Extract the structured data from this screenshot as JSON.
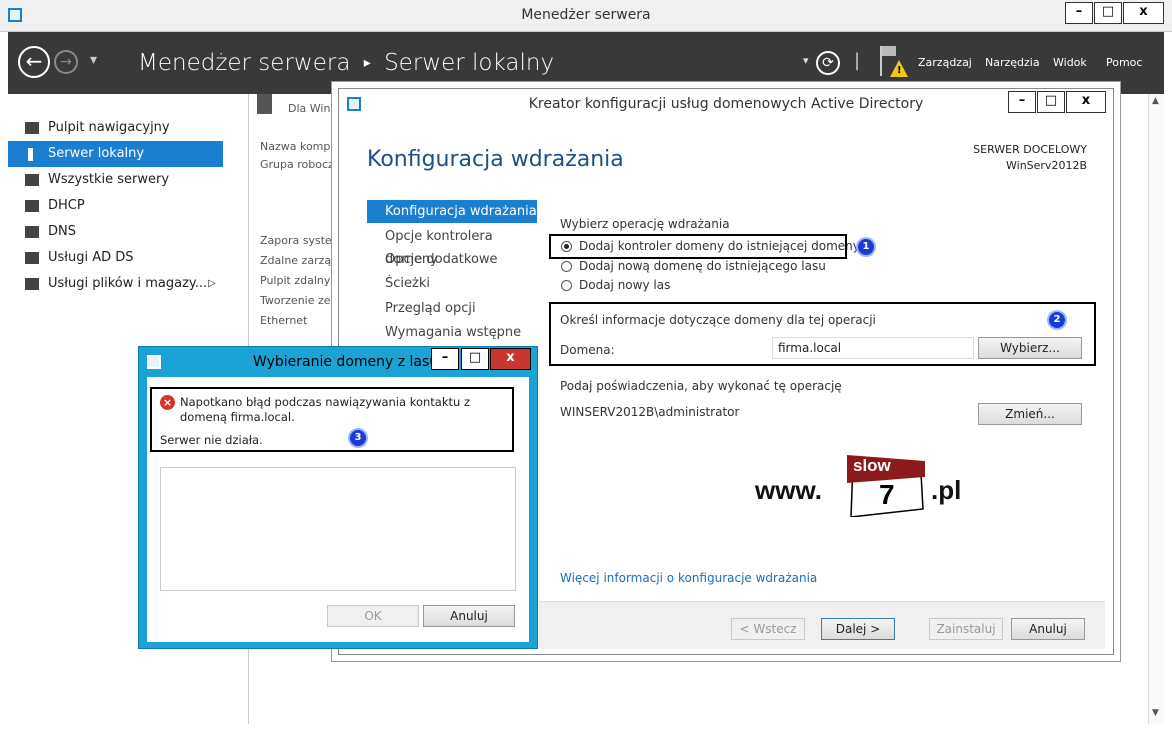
{
  "window": {
    "title": "Menedżer serwera",
    "min": "–",
    "max": "□",
    "close": "x"
  },
  "nav": {
    "app": "Menedżer serwera",
    "sep": "▸",
    "page": "Serwer lokalny",
    "dropdown": "▾",
    "refresh": "⟳",
    "bar": "|",
    "menu": [
      "Zarządzaj",
      "Narzędzia",
      "Widok",
      "Pomoc"
    ]
  },
  "sidebar": {
    "items": [
      {
        "label": "Pulpit nawigacyjny"
      },
      {
        "label": "Serwer lokalny"
      },
      {
        "label": "Wszystkie serwery"
      },
      {
        "label": "DHCP"
      },
      {
        "label": "DNS"
      },
      {
        "label": "Usługi AD DS"
      },
      {
        "label": "Usługi plików i magazy..."
      }
    ],
    "arrow": "▷"
  },
  "background": {
    "dla": "Dla WinS",
    "props1": [
      "Nazwa komput",
      "Grupa robocza"
    ],
    "props2": [
      "Zapora system",
      "Zdalne zarządz",
      "Pulpit zdalny",
      "Tworzenie zesp",
      "Ethernet"
    ]
  },
  "wizard": {
    "title": "Kreator konfiguracji usług domenowych Active Directory",
    "heading": "Konfiguracja wdrażania",
    "target_label": "SERWER DOCELOWY",
    "target_name": "WinServ2012B",
    "nav": [
      "Konfiguracja wdrażania",
      "Opcje kontrolera domeny",
      "Opcje dodatkowe",
      "Ścieżki",
      "Przegląd opcji",
      "Wymagania wstępne"
    ],
    "op_label": "Wybierz operację wdrażania",
    "options": [
      "Dodaj kontroler domeny do istniejącej domeny",
      "Dodaj nową domenę do istniejącego lasu",
      "Dodaj nowy las"
    ],
    "domain_info": "Określ informacje dotyczące domeny dla tej operacji",
    "domain_label": "Domena:",
    "domain_value": "firma.local",
    "select_btn": "Wybierz...",
    "cred_label": "Podaj poświadczenia, aby wykonać tę operację",
    "cred_value": "WINSERV2012B\\administrator",
    "change_btn": "Zmień...",
    "more_link": "Więcej informacji o konfiguracje wdrażania",
    "buttons": {
      "back": "< Wstecz",
      "next": "Dalej >",
      "install": "Zainstaluj",
      "cancel": "Anuluj"
    }
  },
  "dialog": {
    "title": "Wybieranie domeny z lasu",
    "error": "Napotkano błąd podczas nawiązywania kontaktu z domeną firma.local.",
    "error2": "Serwer nie działa.",
    "ok": "OK",
    "cancel": "Anuluj"
  },
  "annotations": [
    "1",
    "2",
    "3"
  ],
  "logo": {
    "www": "www.",
    "slow": "slow",
    "seven": "7",
    "pl": ".pl"
  },
  "colors": {
    "accent": "#1a7fd0",
    "nav_bg": "#393939",
    "dialog_frame": "#1aa3d4",
    "badge": "#1a3bd6"
  }
}
